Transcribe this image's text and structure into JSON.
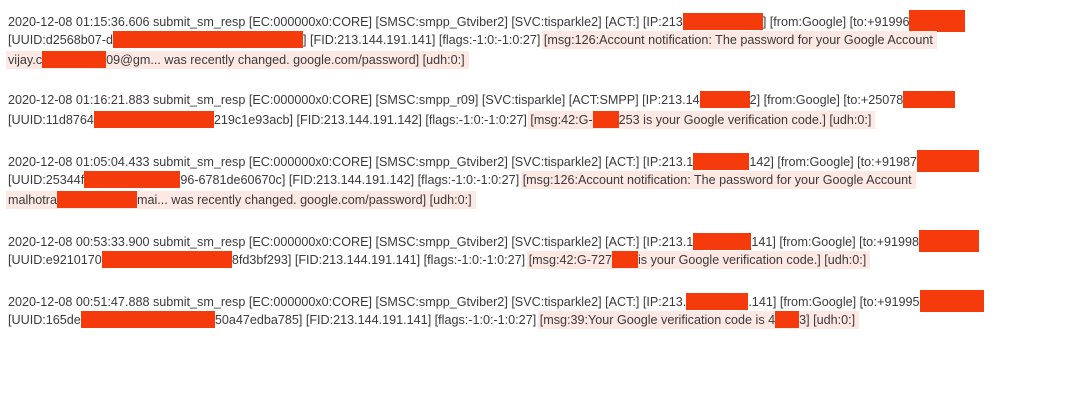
{
  "colors": {
    "redaction": "#f53b0b",
    "message_highlight": "#fde8e4",
    "text": "#3a3a3a",
    "background": "#ffffff"
  },
  "entries": [
    {
      "l1_a": "2020-12-08 01:15:36.606 submit_sm_resp [EC:000000x0:CORE] [SMSC:smpp_Gtviber2] [SVC:tisparkle2] [ACT:] [IP:213",
      "l1_b": "] [from:Google] [to:+91996",
      "l2_a": "[UUID:d2568b07-d",
      "l2_b": "] [FID:213.144.191.141] [flags:-1:0:-1:0:27] ",
      "l2_msg": "[msg:126:Account notification: The password for your Google Account",
      "l3_msg_a": "vijay.c",
      "l3_msg_b": "09@gm... was recently changed. google.com/password] [udh:0:]"
    },
    {
      "l1_a": "2020-12-08 01:16:21.883 submit_sm_resp [EC:000000x0:CORE] [SMSC:smpp_r09] [SVC:tisparkle] [ACT:SMPP] [IP:213.14",
      "l1_b": "2] [from:Google] [to:+25078",
      "l2_a": "[UUID:11d8764",
      "l2_b": "219c1e93acb] [FID:213.144.191.142] [flags:-1:0:-1:0:27] ",
      "l2_msg_a": "[msg:42:G-",
      "l2_msg_b": "253 is your Google verification code.] [udh:0:]"
    },
    {
      "l1_a": "2020-12-08 01:05:04.433 submit_sm_resp [EC:000000x0:CORE] [SMSC:smpp_Gtviber2] [SVC:tisparkle2] [ACT:] [IP:213.1",
      "l1_b": "142] [from:Google] [to:+91987",
      "l2_a": "[UUID:25344f",
      "l2_b": "96-6781de60670c] [FID:213.144.191.142] [flags:-1:0:-1:0:27] ",
      "l2_msg": "[msg:126:Account notification: The password for your Google Account",
      "l3_msg_a": "malhotra",
      "l3_msg_b": "mai... was recently changed. google.com/password] [udh:0:]"
    },
    {
      "l1_a": "2020-12-08 00:53:33.900 submit_sm_resp [EC:000000x0:CORE] [SMSC:smpp_Gtviber2] [SVC:tisparkle2] [ACT:] [IP:213.1",
      "l1_b": "141] [from:Google] [to:+91998",
      "l2_a": "[UUID:e9210170",
      "l2_b": "8fd3bf293] [FID:213.144.191.141] [flags:-1:0:-1:0:27] ",
      "l2_msg_a": "[msg:42:G-727",
      "l2_msg_b": "is your Google verification code.] [udh:0:]"
    },
    {
      "l1_a": "2020-12-08 00:51:47.888 submit_sm_resp [EC:000000x0:CORE] [SMSC:smpp_Gtviber2] [SVC:tisparkle2] [ACT:] [IP:213.",
      "l1_b": ".141] [from:Google] [to:+91995",
      "l2_a": "[UUID:165de",
      "l2_b": "50a47edba785] [FID:213.144.191.141] [flags:-1:0:-1:0:27] ",
      "l2_msg_a": "[msg:39:Your Google verification code is 4",
      "l2_msg_b": "3] [udh:0:]"
    }
  ]
}
